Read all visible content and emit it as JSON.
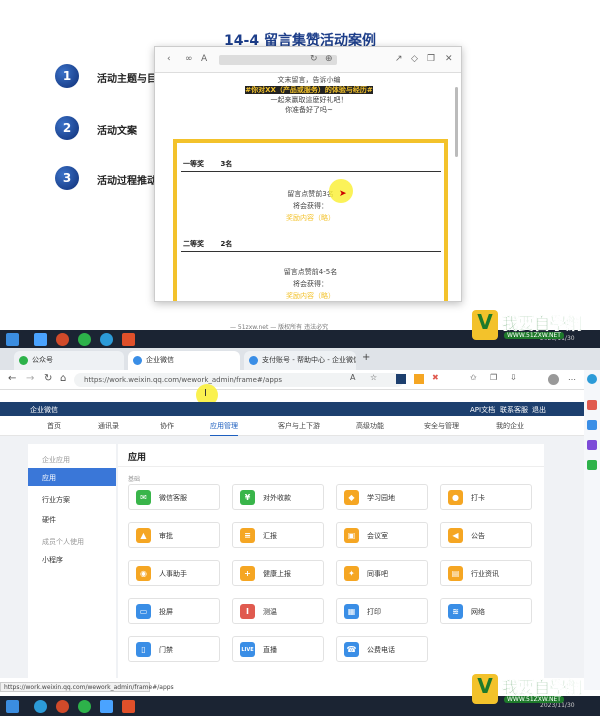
{
  "slide": {
    "title": "14-4  留言集赞活动案例",
    "bullets": [
      {
        "num": "1",
        "label": "活动主题与目"
      },
      {
        "num": "2",
        "label": "活动文案"
      },
      {
        "num": "3",
        "label": "活动过程推动"
      }
    ],
    "footer_partial": "— 51zxw.net — 版权所有 违法必究"
  },
  "popup": {
    "lines": [
      "文末留言，告诉小编",
      "#你对XX（产品或服务）的体验与经历#",
      "一起来赢取這麽好礼吧！",
      "你准备好了吗~"
    ],
    "prize1": {
      "rank": "一等奖",
      "count": "3名",
      "desc": "留言点赞前3名",
      "get": "将会获得：",
      "reward": "奖励内容（略）"
    },
    "prize2": {
      "rank": "二等奖",
      "count": "2名",
      "desc": "留言点赞前4-5名",
      "get": "将会获得：",
      "reward": "奖励内容（略）"
    }
  },
  "watermark": {
    "text": "我要自學網",
    "site": "WWW.51ZXW.NET"
  },
  "taskbar": [
    {
      "time": "2023/11/30"
    },
    {
      "time": "2023/11/30"
    }
  ],
  "browser": {
    "tabs": [
      "公众号",
      "企业微信",
      "支付账号 - 帮助中心 - 企业微信"
    ],
    "url": "https://work.weixin.qq.com/wework_admin/frame#/apps",
    "status_url": "https://work.weixin.qq.com/wework_admin/frame#/apps"
  },
  "app": {
    "logo": "企业微信",
    "header_links": [
      "API文档",
      "联系客服",
      "退出"
    ],
    "nav": [
      "首页",
      "通讯录",
      "协作",
      "应用管理",
      "客户与上下游",
      "高级功能",
      "安全与管理",
      "我的企业"
    ],
    "sidebar": {
      "group1": "企业应用",
      "items1": [
        "应用",
        "行业方案",
        "硬件"
      ],
      "group2": "成员个人使用",
      "items2": [
        "小程序"
      ]
    },
    "panel_title": "应用",
    "section_label": "基础",
    "apps": [
      {
        "label": "微信客服",
        "color": "#39b54a",
        "glyph": "✉"
      },
      {
        "label": "对外收款",
        "color": "#39b54a",
        "glyph": "¥"
      },
      {
        "label": "学习园地",
        "color": "#f5a623",
        "glyph": "◆"
      },
      {
        "label": "打卡",
        "color": "#f5a623",
        "glyph": "●"
      },
      {
        "label": "审批",
        "color": "#f5a623",
        "glyph": "▲"
      },
      {
        "label": "汇报",
        "color": "#f5a623",
        "glyph": "≡"
      },
      {
        "label": "会议室",
        "color": "#f5a623",
        "glyph": "▣"
      },
      {
        "label": "公告",
        "color": "#f5a623",
        "glyph": "◀"
      },
      {
        "label": "人事助手",
        "color": "#f5a623",
        "glyph": "◉"
      },
      {
        "label": "健康上报",
        "color": "#f5a623",
        "glyph": "+"
      },
      {
        "label": "同事吧",
        "color": "#f5a623",
        "glyph": "✦"
      },
      {
        "label": "行业资讯",
        "color": "#f5a623",
        "glyph": "▤"
      },
      {
        "label": "投屏",
        "color": "#3a8ee6",
        "glyph": "▭"
      },
      {
        "label": "测温",
        "color": "#e05a4f",
        "glyph": "I"
      },
      {
        "label": "打印",
        "color": "#3a8ee6",
        "glyph": "▦"
      },
      {
        "label": "网络",
        "color": "#3a8ee6",
        "glyph": "≋"
      },
      {
        "label": "门禁",
        "color": "#3a8ee6",
        "glyph": "▯"
      },
      {
        "label": "直播",
        "color": "#3a8ee6",
        "glyph": "LIVE"
      },
      {
        "label": "公费电话",
        "color": "#3a8ee6",
        "glyph": "☎"
      }
    ]
  }
}
